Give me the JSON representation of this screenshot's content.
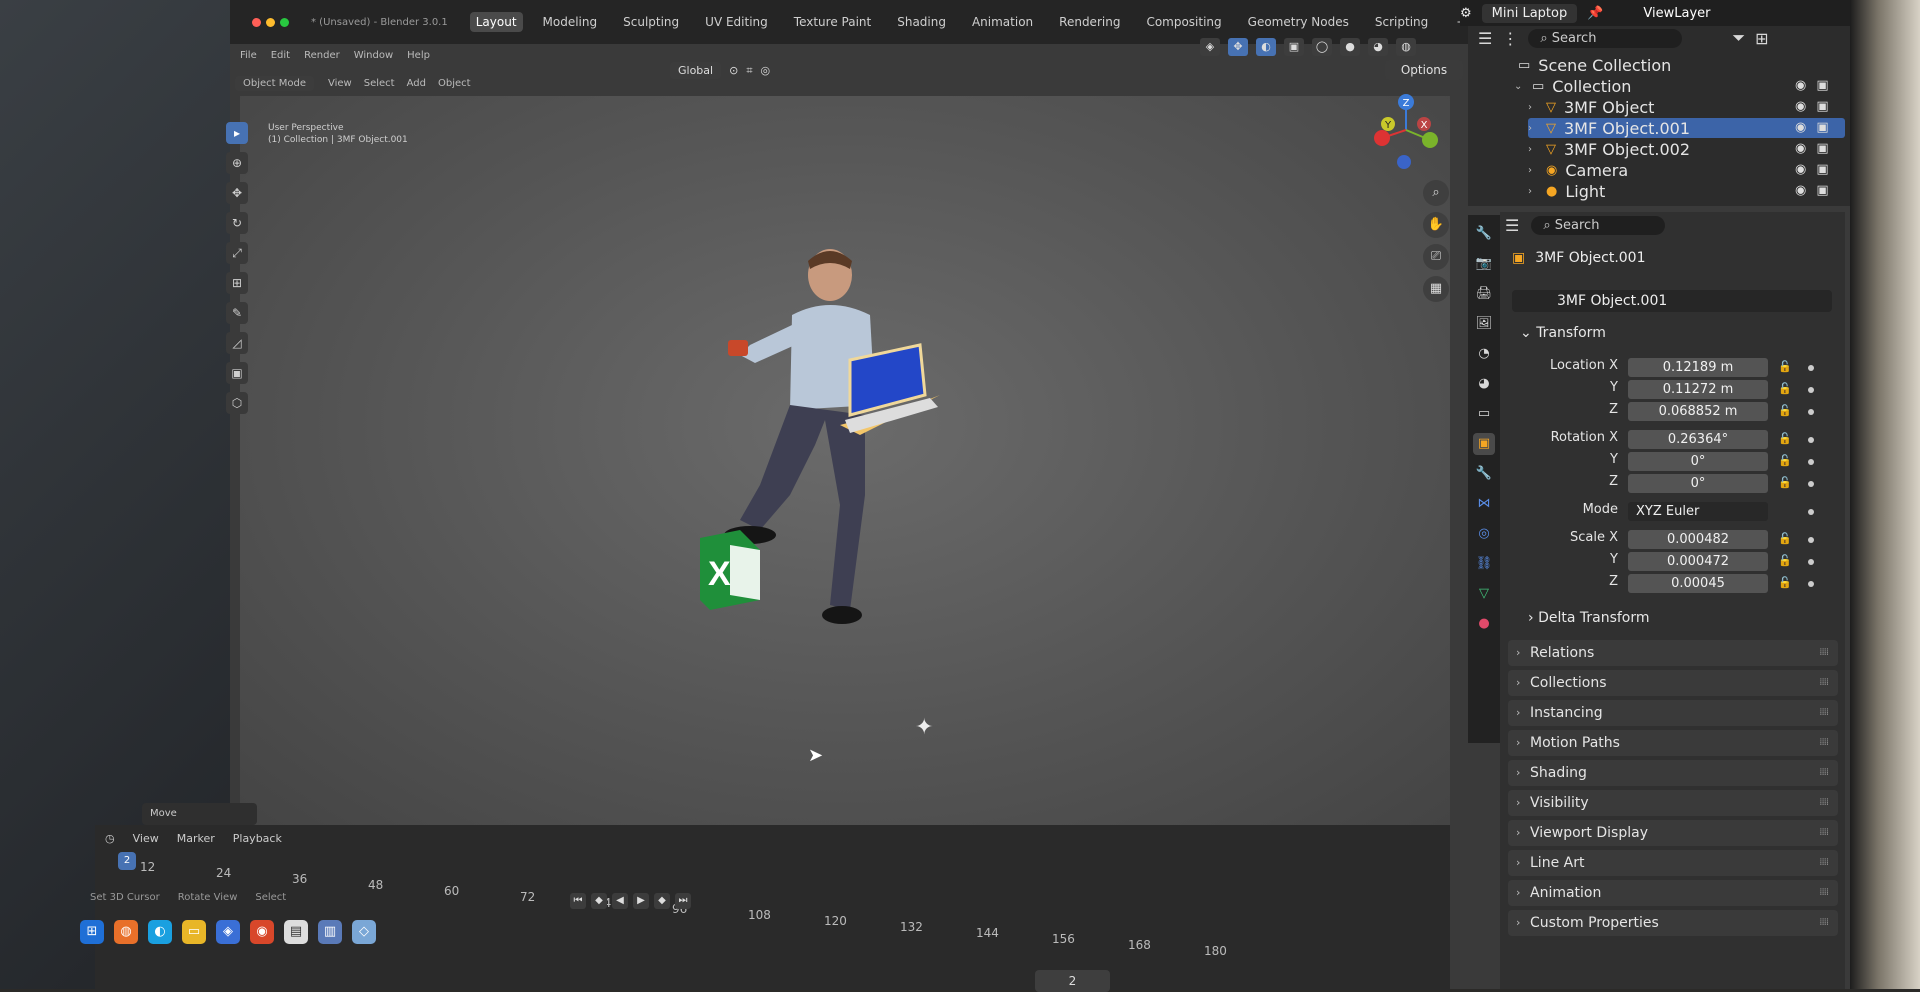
{
  "window": {
    "title": "* (Unsaved) - Blender 3.0.1"
  },
  "menu": [
    "File",
    "Edit",
    "Render",
    "Window",
    "Help"
  ],
  "workspaces": [
    {
      "label": "Layout",
      "active": true
    },
    {
      "label": "Modeling"
    },
    {
      "label": "Sculpting"
    },
    {
      "label": "UV Editing"
    },
    {
      "label": "Texture Paint"
    },
    {
      "label": "Shading"
    },
    {
      "label": "Animation"
    },
    {
      "label": "Rendering"
    },
    {
      "label": "Compositing"
    },
    {
      "label": "Geometry Nodes"
    },
    {
      "label": "Scripting"
    }
  ],
  "add_workspace": "+",
  "viewport_header": {
    "mode": "Object Mode",
    "menus": [
      "View",
      "Select",
      "Add",
      "Object"
    ],
    "orientation": "Global",
    "options_label": "Options"
  },
  "viewport": {
    "perspective": "User Perspective",
    "collection_path": "(1) Collection | 3MF Object.001",
    "operator_panel": "Move",
    "gizmo": {
      "x": "X",
      "y": "Y",
      "z": "Z"
    }
  },
  "timeline": {
    "menus": [
      "View",
      "Marker",
      "Playback"
    ],
    "current_frame": "2",
    "frame_ticks": [
      "12",
      "24",
      "36",
      "48",
      "60",
      "72",
      "84",
      "96",
      "108",
      "120",
      "132",
      "144",
      "156",
      "168",
      "180"
    ],
    "status": [
      "Set 3D Cursor",
      "Rotate View",
      "Select"
    ],
    "frame_field": "2"
  },
  "topright": {
    "scene": "Mini Laptop",
    "view_layer": "ViewLayer"
  },
  "outliner": {
    "search_placeholder": "Search",
    "items": [
      {
        "label": "Scene Collection",
        "level": 0,
        "icon": "scene-collection-icon",
        "glyph": "▭"
      },
      {
        "label": "Collection",
        "level": 1,
        "icon": "collection-icon",
        "glyph": "▭"
      },
      {
        "label": "3MF Object",
        "level": 2,
        "icon": "mesh-icon",
        "glyph": "▽"
      },
      {
        "label": "3MF Object.001",
        "level": 2,
        "icon": "mesh-icon",
        "glyph": "▽",
        "selected": true
      },
      {
        "label": "3MF Object.002",
        "level": 2,
        "icon": "mesh-icon",
        "glyph": "▽"
      },
      {
        "label": "Camera",
        "level": 2,
        "icon": "camera-icon",
        "glyph": "◉"
      },
      {
        "label": "Light",
        "level": 2,
        "icon": "light-icon",
        "glyph": "●"
      }
    ]
  },
  "properties": {
    "search_placeholder": "Search",
    "object_name": "3MF Object.001",
    "object_field": "3MF Object.001",
    "transform": {
      "title": "Transform",
      "location_label": "Location X",
      "location": [
        "0.12189 m",
        "0.11272 m",
        "0.068852 m"
      ],
      "rotation_label": "Rotation X",
      "rotation": [
        "0.26364°",
        "0°",
        "0°"
      ],
      "mode_label": "Mode",
      "mode": "XYZ Euler",
      "scale_label": "Scale X",
      "scale": [
        "0.000482",
        "0.000472",
        "0.00045"
      ],
      "axis_y": "Y",
      "axis_z": "Z",
      "delta": "Delta Transform"
    },
    "panels": [
      "Relations",
      "Collections",
      "Instancing",
      "Motion Paths",
      "Shading",
      "Visibility",
      "Viewport Display",
      "Line Art",
      "Animation",
      "Custom Properties"
    ]
  },
  "colors": {
    "accent": "#4772b3",
    "selection": "#3c64a8",
    "excel_green": "#1f8f3a",
    "laptop_blue": "#2347c8"
  }
}
